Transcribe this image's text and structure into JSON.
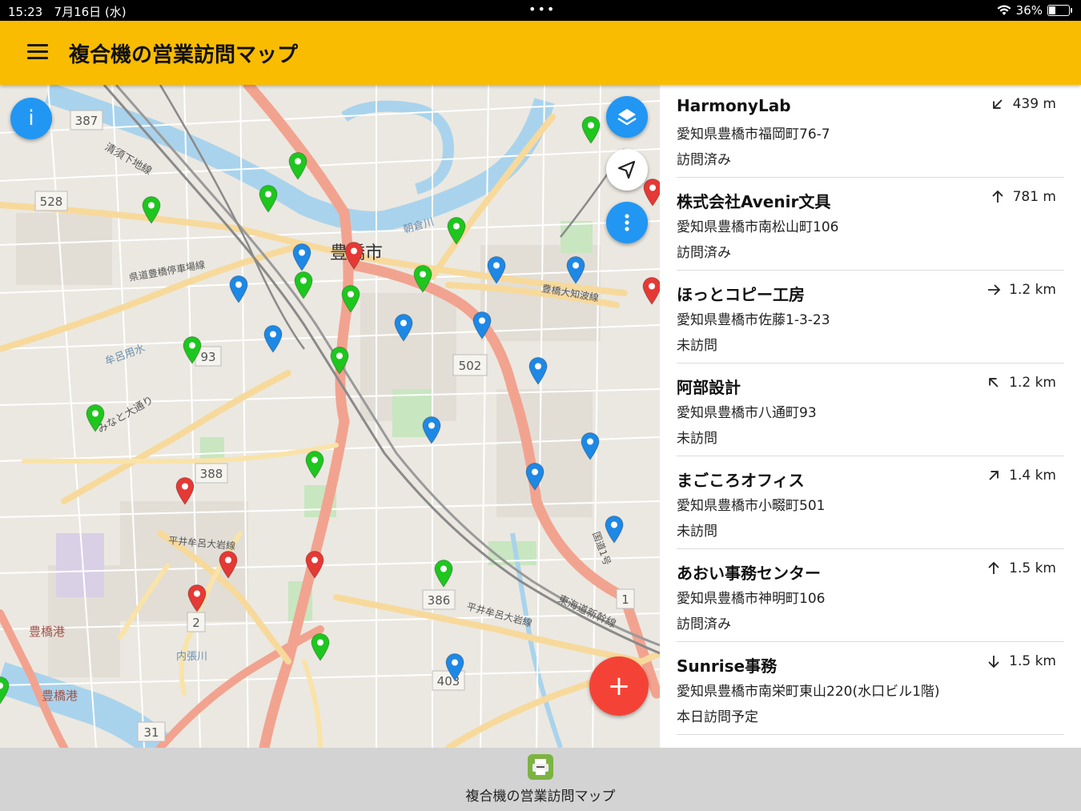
{
  "status_bar": {
    "time": "15:23",
    "date": "7月16日 (水)",
    "more": "•••",
    "battery": "36%"
  },
  "app_bar": {
    "title": "複合機の営業訪問マップ"
  },
  "map": {
    "labels": {
      "route_387": "387",
      "route_528": "528",
      "route_93": "93",
      "route_388": "388",
      "route_502": "502",
      "route_386": "386",
      "route_403": "403",
      "route_31": "31",
      "route_2": "2",
      "route_1": "1",
      "city": "豊橋市",
      "koban": "清須下地線",
      "toyoko": "豊橋港",
      "toyoko2": "豊橋港",
      "hiraiR": "平井牟呂大岩線",
      "hiraiR2": "平井牟呂大岩線",
      "minato": "みなと大通り",
      "uchiura": "内張川",
      "asakura": "朝倉川",
      "mure": "牟呂用水",
      "kendo": "県道豊橋停車場線",
      "toyotaka": "豊橋大知波線",
      "tokaido": "東海道新幹線",
      "kokudo": "国道1号"
    },
    "pins": {
      "green": {
        "color": "#1ec61e"
      },
      "blue": {
        "color": "#1e88e5"
      },
      "red": {
        "color": "#e53935"
      }
    },
    "buttons": {
      "info_label": "i",
      "add_label": "+"
    }
  },
  "list": {
    "items": [
      {
        "name": "HarmonyLab",
        "address": "愛知県豊橋市福岡町76-7",
        "status": "訪問済み",
        "distance": "439 m",
        "direction": "sw"
      },
      {
        "name": "株式会社Avenir文具",
        "address": "愛知県豊橋市南松山町106",
        "status": "訪問済み",
        "distance": "781 m",
        "direction": "n"
      },
      {
        "name": "ほっとコピー工房",
        "address": "愛知県豊橋市佐藤1-3-23",
        "status": "未訪問",
        "distance": "1.2 km",
        "direction": "e"
      },
      {
        "name": "阿部設計",
        "address": "愛知県豊橋市八通町93",
        "status": "未訪問",
        "distance": "1.2 km",
        "direction": "nw"
      },
      {
        "name": "まごころオフィス",
        "address": "愛知県豊橋市小畷町501",
        "status": "未訪問",
        "distance": "1.4 km",
        "direction": "ne"
      },
      {
        "name": "あおい事務センター",
        "address": "愛知県豊橋市神明町106",
        "status": "訪問済み",
        "distance": "1.5 km",
        "direction": "n"
      },
      {
        "name": "Sunrise事務",
        "address": "愛知県豊橋市南栄町東山220(水口ビル1階)",
        "status": "本日訪問予定",
        "distance": "1.5 km",
        "direction": "s"
      }
    ]
  },
  "tab_bar": {
    "label": "複合機の営業訪問マップ"
  }
}
